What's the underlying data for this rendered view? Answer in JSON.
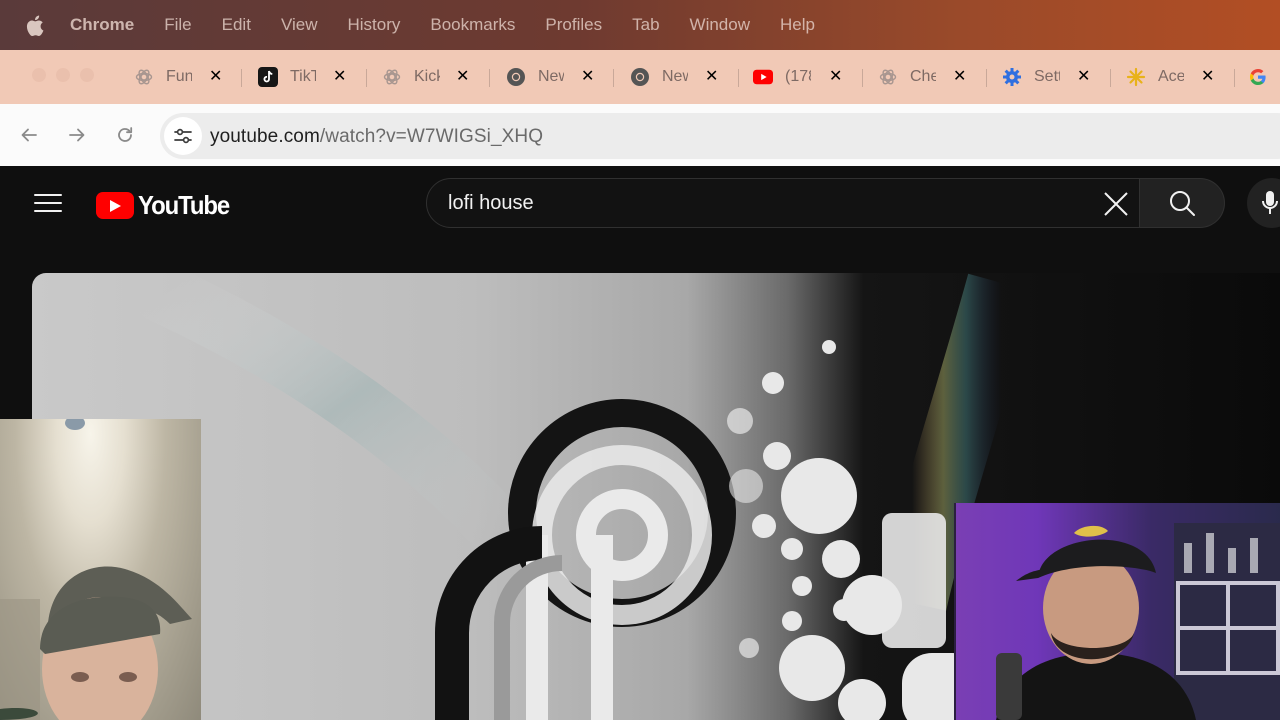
{
  "menubar": {
    "app": "Chrome",
    "items": [
      "File",
      "Edit",
      "View",
      "History",
      "Bookmarks",
      "Profiles",
      "Tab",
      "Window",
      "Help"
    ]
  },
  "tabs": [
    {
      "label": "Fun",
      "icon": "openai-icon"
    },
    {
      "label": "TikT",
      "icon": "tiktok-icon"
    },
    {
      "label": "Kick",
      "icon": "openai-icon"
    },
    {
      "label": "New",
      "icon": "chrome-icon"
    },
    {
      "label": "New",
      "icon": "chrome-icon"
    },
    {
      "label": "(178",
      "icon": "youtube-icon"
    },
    {
      "label": "Che",
      "icon": "openai-icon"
    },
    {
      "label": "Setti",
      "icon": "gear-icon"
    },
    {
      "label": "Ace",
      "icon": "sparkle-icon"
    },
    {
      "label": "",
      "icon": "google-icon"
    }
  ],
  "omnibox": {
    "domain": "youtube.com",
    "path": "/watch?v=W7WIGSi_XHQ"
  },
  "youtube": {
    "logo_text": "YouTube",
    "search_query": "lofi house"
  },
  "colors": {
    "youtube_red": "#ff0000",
    "tab_strip": "#f1c9b6",
    "page_bg": "#0f0f0f"
  }
}
